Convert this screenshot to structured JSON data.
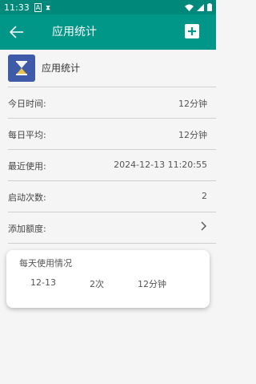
{
  "status_bar": {
    "time": "11:33",
    "icons": [
      "a-box-icon",
      "bluetooth-x-icon",
      "wifi-icon",
      "signal-icon",
      "battery-icon"
    ]
  },
  "app_bar": {
    "title": "应用统计"
  },
  "app": {
    "name": "应用统计"
  },
  "rows": [
    {
      "label": "今日时间:",
      "value": "12分钟"
    },
    {
      "label": "每日平均:",
      "value": "12分钟"
    },
    {
      "label": "最近使用:",
      "value": "2024-12-13 11:20:55"
    },
    {
      "label": "启动次数:",
      "value": "2"
    },
    {
      "label": "添加额度:",
      "value": ""
    }
  ],
  "daily_usage": {
    "title": "每天使用情况",
    "entries": [
      {
        "date": "12-13",
        "count": "2次",
        "duration": "12分钟"
      }
    ]
  },
  "colors": {
    "app_bar": "#009688",
    "status_bar": "#00897b",
    "icon_bg": "#3f5aa8",
    "hourglass": "#e8c24a"
  }
}
